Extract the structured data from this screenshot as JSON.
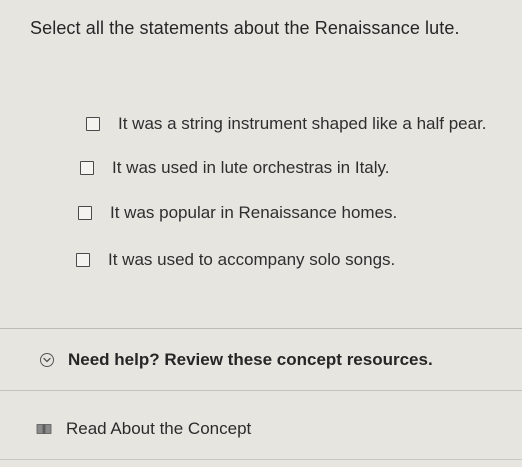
{
  "question": {
    "prompt": "Select all the statements about the Renaissance lute."
  },
  "options": [
    {
      "label": "It was a string instrument shaped like a half pear.",
      "checked": false
    },
    {
      "label": "It was used in lute orchestras in Italy.",
      "checked": false
    },
    {
      "label": "It was popular in Renaissance homes.",
      "checked": false
    },
    {
      "label": "It was used to accompany solo songs.",
      "checked": false
    }
  ],
  "help": {
    "title": "Need help? Review these concept resources.",
    "icon": "chevron-down-circle-icon",
    "resources": [
      {
        "label": "Read About the Concept",
        "icon": "book-icon"
      }
    ]
  }
}
